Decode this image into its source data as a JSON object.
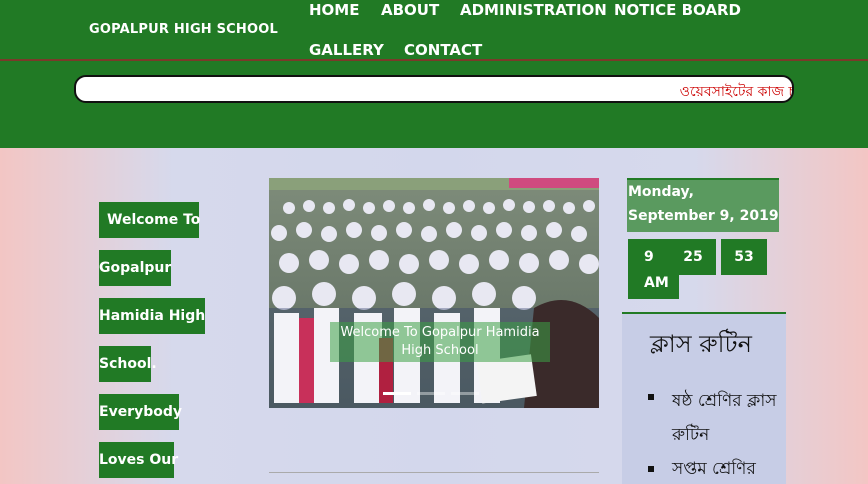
{
  "site": {
    "brand": "GOPALPUR HIGH SCHOOL"
  },
  "nav": {
    "items": [
      "HOME",
      "ABOUT",
      "ADMINISTRATION",
      "NOTICE BOARD",
      "GALLERY",
      "CONTACT"
    ]
  },
  "ticker": {
    "text": "ওয়েবসাইটের কাজ চ"
  },
  "welcome": {
    "lines": [
      "Welcome To",
      "Gopalpur",
      "Hamidia High",
      "School.",
      "Everybody",
      "Loves Our"
    ]
  },
  "slider": {
    "caption": "Welcome To Gopalpur Hamidia High School",
    "active_index": 0,
    "slide_count": 3
  },
  "clock": {
    "date": "Monday, September 9, 2019",
    "hour": "9",
    "minute": "25",
    "second": "53",
    "ampm": "AM"
  },
  "routine": {
    "title": "ক্লাস রুটিন",
    "items": [
      "ষষ্ঠ শ্রেণির ক্লাস রুটিন",
      "সপ্তম শ্রেণির"
    ]
  },
  "colors": {
    "header": "#217a25",
    "ticker_text": "#cc0000"
  }
}
